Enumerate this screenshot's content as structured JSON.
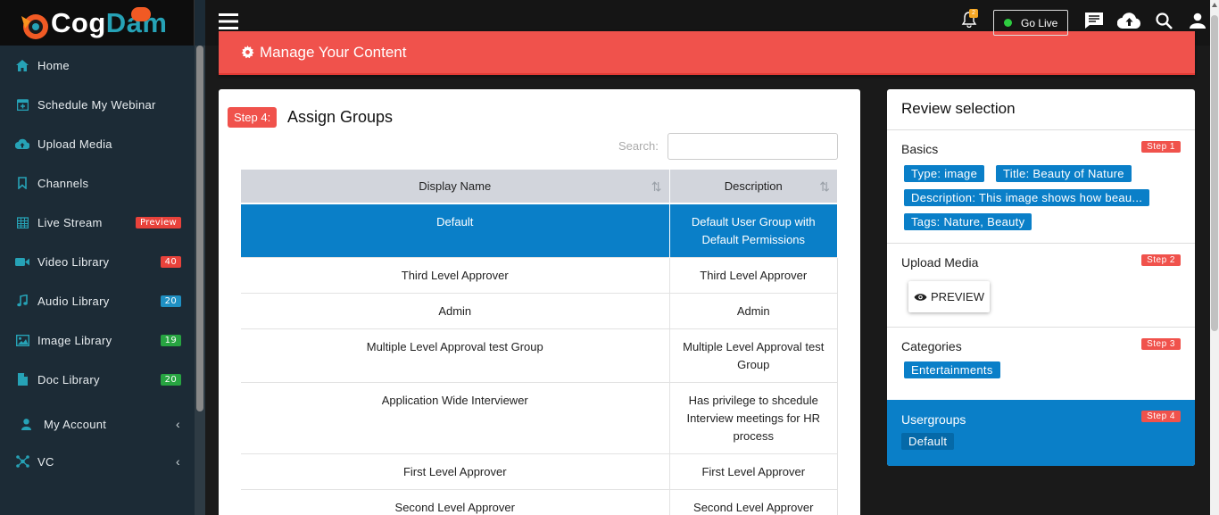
{
  "app": {
    "logo_part1": "Cog",
    "logo_part2": "Dam"
  },
  "sidebar": {
    "items": [
      {
        "label": "Home",
        "icon": "home-icon"
      },
      {
        "label": "Schedule My Webinar",
        "icon": "calendar-plus-icon"
      },
      {
        "label": "Upload Media",
        "icon": "cloud-upload-icon"
      },
      {
        "label": "Channels",
        "icon": "bookmark-icon"
      },
      {
        "label": "Live Stream",
        "icon": "calendar-grid-icon",
        "badge": "Preview",
        "badge_color": "#e8423b"
      },
      {
        "label": "Video Library",
        "icon": "video-camera-icon",
        "badge": "40",
        "badge_color": "#e8423b"
      },
      {
        "label": "Audio Library",
        "icon": "music-note-icon",
        "badge": "20",
        "badge_color": "#1f90c3"
      },
      {
        "label": "Image Library",
        "icon": "image-icon",
        "badge": "19",
        "badge_color": "#27a441"
      },
      {
        "label": "Doc Library",
        "icon": "document-icon",
        "badge": "20",
        "badge_color": "#27a441"
      },
      {
        "label": "My Account",
        "icon": "user-icon"
      },
      {
        "label": "VC",
        "icon": "network-icon"
      }
    ]
  },
  "topbar": {
    "go_live_label": "Go Live",
    "notification_count": "2"
  },
  "banner": {
    "title": "Manage Your Content"
  },
  "main": {
    "step_label": "Step 4:",
    "heading": "Assign Groups",
    "search_label": "Search:",
    "search_value": "",
    "columns": [
      "Display Name",
      "Description"
    ],
    "rows": [
      {
        "name": "Default",
        "description": "Default User Group with Default Permissions",
        "selected": true
      },
      {
        "name": "Third Level Approver",
        "description": "Third Level Approver"
      },
      {
        "name": "Admin",
        "description": "Admin"
      },
      {
        "name": "Multiple Level Approval test Group",
        "description": "Multiple Level Approval test Group"
      },
      {
        "name": "Application Wide Interviewer",
        "description": "Has privilege to shcedule Interview meetings for HR process"
      },
      {
        "name": "First Level Approver",
        "description": "First Level Approver"
      },
      {
        "name": "Second Level Approver",
        "description": "Second Level Approver"
      }
    ]
  },
  "review": {
    "title": "Review selection",
    "basics": {
      "heading": "Basics",
      "step": "Step 1",
      "chips": [
        "Type: image",
        "Title: Beauty of Nature",
        "Description: This image shows how beau...",
        "Tags: Nature, Beauty"
      ]
    },
    "upload": {
      "heading": "Upload Media",
      "step": "Step 2",
      "preview_label": "PREVIEW"
    },
    "categories": {
      "heading": "Categories",
      "step": "Step 3",
      "chips": [
        "Entertainments"
      ]
    },
    "usergroups": {
      "heading": "Usergroups",
      "step": "Step 4",
      "chips": [
        "Default"
      ]
    }
  },
  "colors": {
    "accent_red": "#f0524c",
    "selection_blue": "#0a7fc8",
    "sidebar_bg": "#1c2b36",
    "icon_cyan": "#26a2b6"
  }
}
